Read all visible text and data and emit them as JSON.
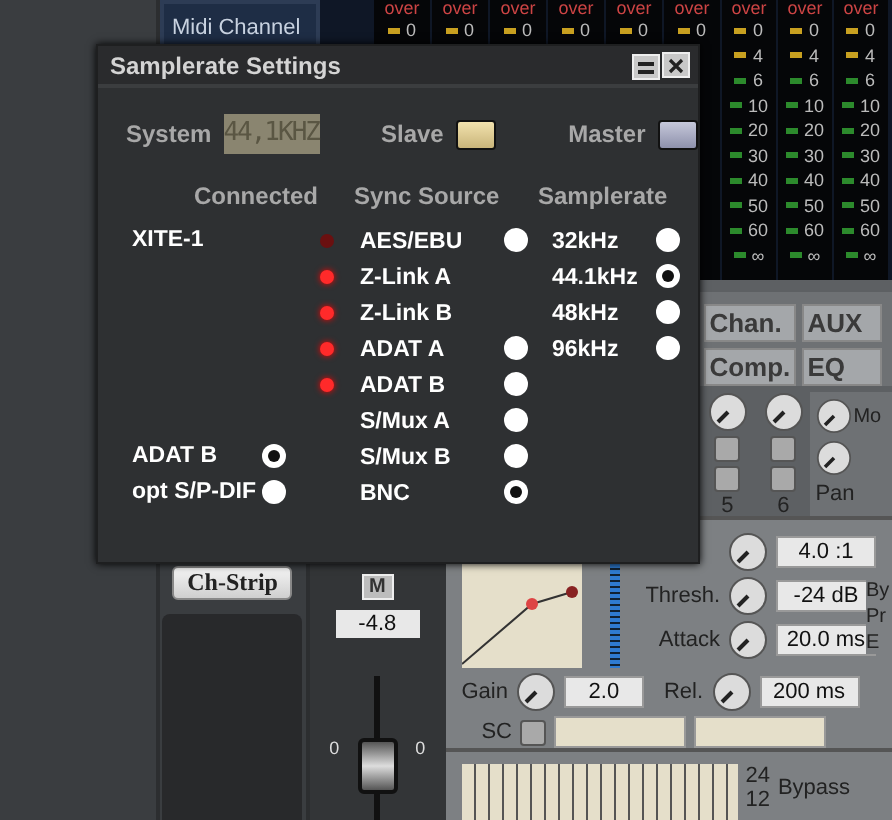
{
  "mixer": {
    "midi_label": "Midi Channel",
    "meters": [
      {
        "kind": "header",
        "header": "over",
        "value": "0"
      },
      {
        "kind": "header",
        "header": "over",
        "value": "0"
      },
      {
        "kind": "header",
        "header": "over",
        "value": "0"
      },
      {
        "kind": "header",
        "header": "over",
        "value": "0"
      },
      {
        "kind": "header",
        "header": "over",
        "value": "0"
      },
      {
        "kind": "header",
        "header": "over",
        "value": "0"
      },
      {
        "kind": "full",
        "header": "over",
        "scale": [
          "0",
          "4",
          "6",
          "10",
          "20",
          "30",
          "40",
          "50",
          "60",
          "∞"
        ]
      },
      {
        "kind": "full",
        "header": "over",
        "scale": [
          "0",
          "4",
          "6",
          "10",
          "20",
          "30",
          "40",
          "50",
          "60",
          "∞"
        ]
      },
      {
        "kind": "full",
        "header": "over",
        "scale": [
          "0",
          "4",
          "6",
          "10",
          "20",
          "30",
          "40",
          "50",
          "60",
          "∞"
        ]
      }
    ],
    "strip_button": "Ch-Strip",
    "mute_button": "M",
    "fader_value": "-4.8",
    "fader_scale": [
      "0",
      "0"
    ],
    "fader": {
      "level": 0.3
    },
    "tabs": [
      {
        "label": "Chan."
      },
      {
        "label": "AUX"
      },
      {
        "label": "Comp."
      },
      {
        "label": "EQ"
      }
    ],
    "knob_labels": [
      "5",
      "6"
    ],
    "pan_label": "Pan",
    "mode_label": "Mo",
    "compressor": {
      "ratio": "4.0 :1",
      "params": [
        {
          "label": "Thresh.",
          "value": "-24 dB"
        },
        {
          "label": "Attack",
          "value": "20.0 ms"
        }
      ],
      "gain": {
        "label": "Gain",
        "value": "2.0"
      },
      "release": {
        "label": "Rel.",
        "value": "200 ms"
      },
      "sc_label": "SC",
      "side_labels": [
        "By",
        "Pr",
        "E"
      ]
    },
    "eq": {
      "top_label": "24",
      "bypass_label": "Bypass",
      "bottom_label": "12"
    }
  },
  "dialog": {
    "title": "Samplerate Settings",
    "system_label": "System",
    "system_value": "44,1KHZ",
    "modes": [
      {
        "label": "Slave",
        "selected": true
      },
      {
        "label": "Master",
        "selected": false
      }
    ],
    "headers": [
      "Connected",
      "Sync Source",
      "Samplerate"
    ],
    "inputs": [
      {
        "kind": "label",
        "name": "XITE-1"
      },
      {
        "kind": "radio",
        "name": "ADAT B",
        "selected": true
      },
      {
        "kind": "radio",
        "name": "opt S/P-DIF",
        "selected": false
      }
    ],
    "sync_sources": [
      {
        "label": "AES/EBU",
        "led": false,
        "kind": "radio",
        "selected": false
      },
      {
        "label": "Z-Link A",
        "led": true,
        "kind": "label"
      },
      {
        "label": "Z-Link B",
        "led": true,
        "kind": "label"
      },
      {
        "label": "ADAT A",
        "led": true,
        "kind": "radio",
        "selected": false
      },
      {
        "label": "ADAT B",
        "led": true,
        "kind": "radio",
        "selected": false
      },
      {
        "label": "S/Mux A",
        "kind": "radio",
        "selected": false
      },
      {
        "label": "S/Mux B",
        "kind": "radio",
        "selected": false
      },
      {
        "label": "BNC",
        "kind": "radio",
        "selected": true
      }
    ],
    "samplerates": [
      {
        "label": "32kHz",
        "selected": false
      },
      {
        "label": "44.1kHz",
        "selected": true
      },
      {
        "label": "48kHz",
        "selected": false
      },
      {
        "label": "96kHz",
        "selected": false
      }
    ]
  }
}
